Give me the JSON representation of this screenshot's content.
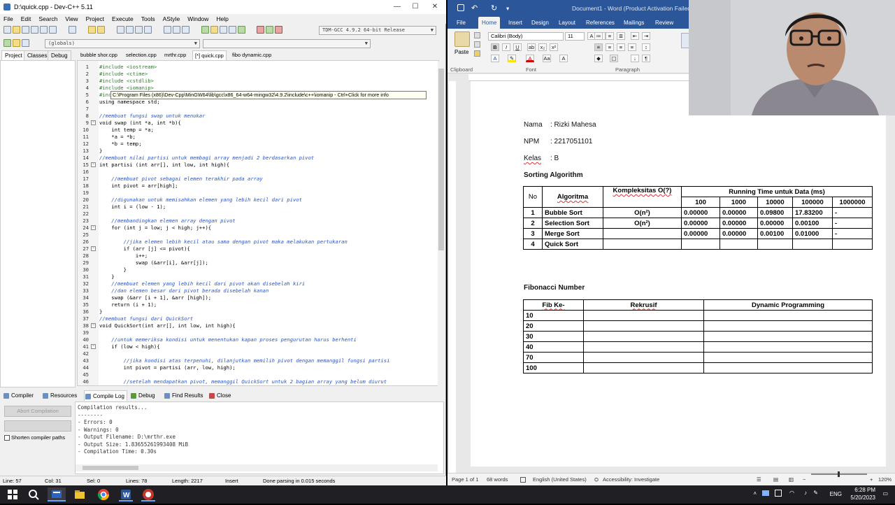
{
  "devcpp": {
    "title": "D:\\quick.cpp - Dev-C++ 5.11",
    "menu": [
      "File",
      "Edit",
      "Search",
      "View",
      "Project",
      "Execute",
      "Tools",
      "AStyle",
      "Window",
      "Help"
    ],
    "compiler_select": "TDM-GCC 4.9.2 64-bit Release",
    "scope_select": "(globals)",
    "panel_tabs": [
      "Project",
      "Classes",
      "Debug"
    ],
    "file_tabs": [
      "bubble shor.cpp",
      "selection.cpp",
      "mrthr.cpp",
      "[*] quick.cpp",
      "fibo dynamic.cpp"
    ],
    "active_file_tab": "[*] quick.cpp",
    "tooltip": "C:\\Program Files (x86)\\Dev-Cpp\\MinGW64\\lib\\gcc\\x86_64-w64-mingw32\\4.9.2\\include\\c++\\iomanip - Ctrl+Click for more info",
    "line_numbers": [
      "1",
      "2",
      "3",
      "4",
      "5",
      "6",
      "7",
      "8",
      "9",
      "10",
      "11",
      "12",
      "13",
      "14",
      "15",
      "16",
      "17",
      "18",
      "19",
      "20",
      "21",
      "22",
      "23",
      "24",
      "25",
      "26",
      "27",
      "28",
      "29",
      "30",
      "31",
      "32",
      "33",
      "34",
      "35",
      "36",
      "37",
      "38",
      "39",
      "40",
      "41",
      "42",
      "43",
      "44",
      "45",
      "46"
    ],
    "code_lines": [
      "#include <iostream>",
      "#include <ctime>",
      "#include <cstdlib>",
      "#include <iomanip>",
      "#inc",
      "using namespace std;",
      "",
      "//membuat fungsi swap untuk menukar",
      "void swap (int *a, int *b){",
      "    int temp = *a;",
      "    *a = *b;",
      "    *b = temp;",
      "}",
      "//membuat nilai partisi untuk membagi array menjadi 2 berdasarkan pivot",
      "int partisi (int arr[], int low, int high){",
      "",
      "    //membuat pivot sebagai elemen terakhir pada array",
      "    int pivot = arr[high];",
      "",
      "    //digunakan untuk memisahkan elemen yang lebih kecil dari pivot",
      "    int i = (low - 1);",
      "",
      "    //membandingkan elemen array dengan pivot",
      "    for (int j = low; j < high; j++){",
      "",
      "        //jika elemen lebih kecil atau sama dengan pivot maka melakukan pertukaran",
      "        if (arr [j] <= pivot){",
      "            i++;",
      "            swap (&arr[i], &arr[j]);",
      "        }",
      "    }",
      "    //membuat elemen yang lebih kecil dari pivot akan disebelah kiri",
      "    //dan elemen besar dari pivot berada disebelah kanan",
      "    swap (&arr [i + 1], &arr [high]);",
      "    return (i + 1);",
      "}",
      "//membuat fungsi dari QuickSort",
      "void QuickSort(int arr[], int low, int high){",
      "",
      "    //untuk memeriksa kondisi untuk menentukan kapan proses pengurutan harus berhenti",
      "    if (low < high){",
      "",
      "        //jika kondisi atas terpenuhi, dilanjutkan memilih pivot dengan memanggil fungsi partisi",
      "        int pivot = partisi (arr, low, high);",
      "",
      "        //setelah mendapatkan pivot, memanggil QuickSort untuk 2 bagian array yang belum diurut"
    ],
    "bottom_tabs": [
      "Compiler",
      "Resources",
      "Compile Log",
      "Debug",
      "Find Results",
      "Close"
    ],
    "active_bottom_tab": "Compile Log",
    "abort_button": "Abort Compilation",
    "shorten_label": "Shorten compiler paths",
    "compile_log": [
      "Compilation results...",
      "--------",
      "- Errors: 0",
      "- Warnings: 0",
      "- Output Filename: D:\\mrthr.exe",
      "- Output Size: 1.83655261993408 MiB",
      "- Compilation Time: 0.30s"
    ],
    "status": {
      "line": "Line:  57",
      "col": "Col:  31",
      "sel": "Sel:  0",
      "lines": "Lines:  78",
      "length": "Length:  2217",
      "mode": "Insert",
      "parse": "Done parsing in 0.015 seconds"
    }
  },
  "word": {
    "title": "Document1  -  Word (Product Activation Failed)",
    "tabs": [
      "File",
      "Home",
      "Insert",
      "Design",
      "Layout",
      "References",
      "Mailings",
      "Review"
    ],
    "active_tab": "Home",
    "font_name": "Calibri (Body)",
    "font_size": "11",
    "paste_label": "Paste",
    "groups": [
      "Clipboard",
      "Font",
      "Paragraph"
    ],
    "fields": [
      {
        "label": "Nama",
        "value": ": Rizki Mahesa"
      },
      {
        "label": "NPM",
        "value": ": 2217051101"
      },
      {
        "label": "Kelas",
        "value": ": B"
      }
    ],
    "heading1": "Sorting Algorithm",
    "sort_table": {
      "h_no": "No",
      "h_alg": "Algoritma",
      "h_complex": "Kompleksitas O(?)",
      "h_running": "Running Time untuk Data (ms)",
      "sizes": [
        "100",
        "1000",
        "10000",
        "100000",
        "1000000"
      ],
      "rows": [
        {
          "no": "1",
          "alg": "Bubble Sort",
          "complex": "O(n²)",
          "vals": [
            "0.00000",
            "0.00000",
            "0.09800",
            "17.83200",
            "-"
          ]
        },
        {
          "no": "2",
          "alg": "Selection Sort",
          "complex": "O(n²)",
          "vals": [
            "0.00000",
            "0.00000",
            "0.00000",
            "0.00100",
            "-"
          ]
        },
        {
          "no": "3",
          "alg": "Merge Sort",
          "complex": "",
          "vals": [
            "0.00000",
            "0.00000",
            "0.00100",
            "0.01000",
            "-"
          ]
        },
        {
          "no": "4",
          "alg": "Quick Sort",
          "complex": "",
          "vals": [
            "",
            "",
            "",
            "",
            ""
          ]
        }
      ]
    },
    "heading2": "Fibonacci Number",
    "fib_table": {
      "h_fib": "Fib Ke-",
      "h_rec": "Rekrusif",
      "h_dp": "Dynamic Programming",
      "rows": [
        "10",
        "20",
        "30",
        "40",
        "70",
        "100"
      ]
    },
    "status": {
      "page": "Page 1 of 1",
      "words": "68 words",
      "lang": "English (United States)",
      "access": "Accessibility: Investigate",
      "zoom": "120%"
    }
  },
  "taskbar": {
    "lang": "ENG",
    "time": "6:28 PM",
    "date": "5/20/2023"
  }
}
